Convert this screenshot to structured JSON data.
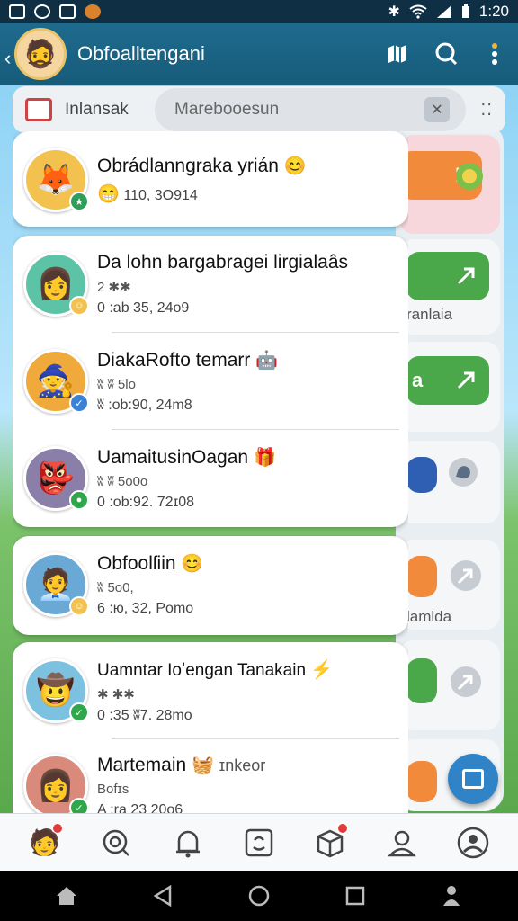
{
  "status_bar": {
    "time": "1:20"
  },
  "header": {
    "title": "Obfoalltengani"
  },
  "search": {
    "tab_label": "Inlansak",
    "placeholder": "Marebooesun"
  },
  "side_panel": {
    "labels": [
      "ranlaia",
      "a",
      "lamlda"
    ]
  },
  "chats": [
    {
      "name": "Obrádlanngraka yrián",
      "time": "110, 3О914",
      "sub": "",
      "avatar_color": "#f2c14e",
      "badge_color": "#2e9e5b"
    },
    {
      "name": "Da lohn bargabragei lirgialaâs",
      "sub": "2 ✱✱",
      "time": "0 :ab 35, 24о9",
      "avatar_color": "#5cc3a6",
      "badge_color": "#f2c14e"
    },
    {
      "name": "DiakaRofto temarr",
      "sub": "ʬ ʬ 5lo",
      "time": "ʬ :ob:90, 24m8",
      "avatar_color": "#f0a93b",
      "badge_color": "#3b82d6"
    },
    {
      "name": "UamaitusinOagan",
      "sub": "ʬ ʬ 5o0o",
      "time": "0 :ob:92. 72ɪ08",
      "avatar_color": "#8a7fa8",
      "badge_color": "#2ea84a"
    },
    {
      "name": "Obfoolſiin",
      "sub": "ʬ 5o0,",
      "time": "6 :ю, 32, Pomo",
      "avatar_color": "#6aa9d6",
      "badge_color": "#f2c14e"
    },
    {
      "name": "Uamntar Ioʼengan Tanakain",
      "sub": "✱ ✱✱",
      "time": "0 :35 ʬ7. 28mo",
      "avatar_color": "#7cc2e0",
      "badge_color": "#2ea84a"
    },
    {
      "name": "Martemain",
      "name_extra": "ɪnkeor",
      "sub": "Bofɪs",
      "time": "A :ra 23 20o6",
      "avatar_color": "#d98a7a",
      "badge_color": "#2ea84a"
    }
  ],
  "icons": {
    "status": [
      "gallery-icon",
      "sync-icon",
      "screenshot-icon",
      "notification-icon",
      "bluetooth-icon",
      "wifi-icon",
      "signal-icon",
      "battery-icon"
    ],
    "header": [
      "map-icon",
      "search-icon",
      "more-icon"
    ],
    "tabs": [
      "avatar-tab-icon",
      "chat-search-icon",
      "bell-icon",
      "sticker-icon",
      "box-icon",
      "profile-icon",
      "settings-icon"
    ],
    "nav": [
      "home-icon",
      "back-icon",
      "circle-home-icon",
      "recents-icon",
      "accessibility-icon"
    ]
  },
  "colors": {
    "header": "#1e6b8e",
    "accent": "#2f83c6",
    "badge": "#e23b3b"
  }
}
